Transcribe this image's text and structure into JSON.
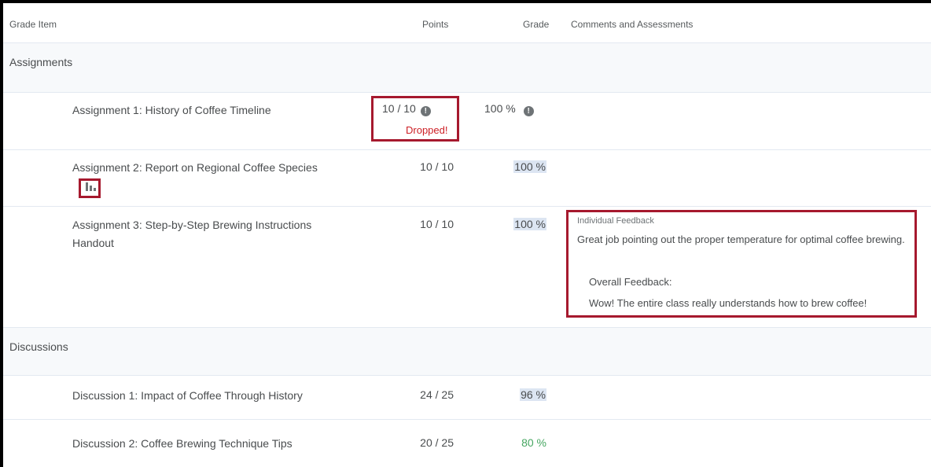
{
  "table": {
    "headers": {
      "grade_item": "Grade Item",
      "points": "Points",
      "grade": "Grade",
      "comments": "Comments and Assessments"
    },
    "categories": [
      {
        "name": "Assignments",
        "items": [
          {
            "name": "Assignment 1: History of Coffee Timeline",
            "points": "10 / 10",
            "grade": "100 %",
            "status": "Dropped!"
          },
          {
            "name": "Assignment 2: Report on Regional Coffee Species",
            "points": "10 / 10",
            "grade": "100 %"
          },
          {
            "name_line1": "Assignment 3: Step-by-Step Brewing Instructions",
            "name_line2": "Handout",
            "points": "10 / 10",
            "grade": "100 %",
            "feedback": {
              "label": "Individual Feedback",
              "text": "Great job pointing out the proper temperature for optimal coffee brewing.",
              "overall_label": "Overall Feedback:",
              "overall_text": "Wow! The entire class really understands how to brew coffee!"
            }
          }
        ]
      },
      {
        "name": "Discussions",
        "items": [
          {
            "name": "Discussion 1: Impact of Coffee Through History",
            "points": "24 / 25",
            "grade": "96 %"
          },
          {
            "name": "Discussion 2: Coffee Brewing Technique Tips",
            "points": "20 / 25",
            "grade": "80 %"
          }
        ]
      }
    ]
  },
  "icons": {
    "info": "exclamation-circle-icon",
    "stats": "bar-chart-icon",
    "info_glyph": "!"
  },
  "colors": {
    "highlight_box": "#a6192e",
    "dropped_text": "#cd2026",
    "grade_highlight": "#dce5f2",
    "grade_green": "#46a661",
    "category_bg": "#f7f9fb"
  }
}
